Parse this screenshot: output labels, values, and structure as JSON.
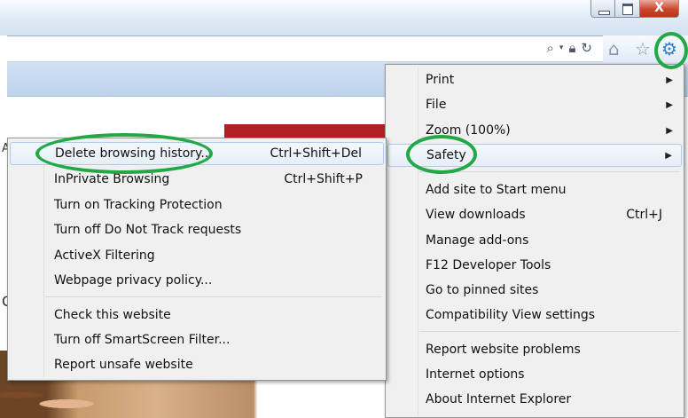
{
  "browser": {
    "window_controls": {
      "minimize_icon": "minimize-icon",
      "maximize_icon": "maximize-icon",
      "close_glyph": "X"
    },
    "address_icons": [
      "search-icon",
      "dropdown-arrow-icon",
      "lock-icon",
      "refresh-icon"
    ],
    "toolbar_icons": [
      "home-icon",
      "star-icon",
      "gear-icon"
    ]
  },
  "page": {
    "edge_char_1": "A",
    "edge_char_2": "C"
  },
  "tools_menu": {
    "items": [
      {
        "label": "Print",
        "has_submenu": true
      },
      {
        "label": "File",
        "has_submenu": true
      },
      {
        "label": "Zoom (100%)",
        "has_submenu": true
      },
      {
        "label": "Safety",
        "has_submenu": true,
        "highlighted": true
      },
      {
        "label": "Add site to Start menu"
      },
      {
        "label": "View downloads",
        "shortcut": "Ctrl+J"
      },
      {
        "label": "Manage add-ons"
      },
      {
        "label": "F12 Developer Tools"
      },
      {
        "label": "Go to pinned sites"
      },
      {
        "label": "Compatibility View settings"
      },
      {
        "label": "Report website problems"
      },
      {
        "label": "Internet options"
      },
      {
        "label": "About Internet Explorer"
      }
    ]
  },
  "safety_submenu": {
    "items": [
      {
        "label": "Delete browsing history...",
        "shortcut": "Ctrl+Shift+Del",
        "highlighted": true
      },
      {
        "label": "InPrivate Browsing",
        "shortcut": "Ctrl+Shift+P"
      },
      {
        "label": "Turn on Tracking Protection"
      },
      {
        "label": "Turn off Do Not Track requests"
      },
      {
        "label": "ActiveX Filtering"
      },
      {
        "label": "Webpage privacy policy..."
      },
      {
        "label": "Check this website"
      },
      {
        "label": "Turn off SmartScreen Filter..."
      },
      {
        "label": "Report unsafe website"
      }
    ]
  },
  "colors": {
    "highlight_border": "#aecbeb",
    "annotation_green": "#22a845",
    "gear_blue": "#2f7fcc"
  }
}
